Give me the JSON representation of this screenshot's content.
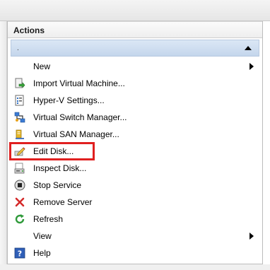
{
  "panel": {
    "title": "Actions",
    "section_label": "."
  },
  "menu": [
    {
      "label": "New",
      "icon": "none",
      "submenu": true
    },
    {
      "label": "Import Virtual Machine...",
      "icon": "import-vm-icon",
      "submenu": false
    },
    {
      "label": "Hyper-V Settings...",
      "icon": "settings-icon",
      "submenu": false
    },
    {
      "label": "Virtual Switch Manager...",
      "icon": "switch-icon",
      "submenu": false
    },
    {
      "label": "Virtual SAN Manager...",
      "icon": "san-icon",
      "submenu": false
    },
    {
      "label": "Edit Disk...",
      "icon": "edit-disk-icon",
      "submenu": false,
      "highlighted": true
    },
    {
      "label": "Inspect Disk...",
      "icon": "inspect-disk-icon",
      "submenu": false
    },
    {
      "label": "Stop Service",
      "icon": "stop-icon",
      "submenu": false
    },
    {
      "label": "Remove Server",
      "icon": "remove-icon",
      "submenu": false
    },
    {
      "label": "Refresh",
      "icon": "refresh-icon",
      "submenu": false
    },
    {
      "label": "View",
      "icon": "none",
      "submenu": true
    },
    {
      "label": "Help",
      "icon": "help-icon",
      "submenu": false
    }
  ],
  "colors": {
    "highlight": "#e02020",
    "section_bar": "#c4d6ec"
  }
}
